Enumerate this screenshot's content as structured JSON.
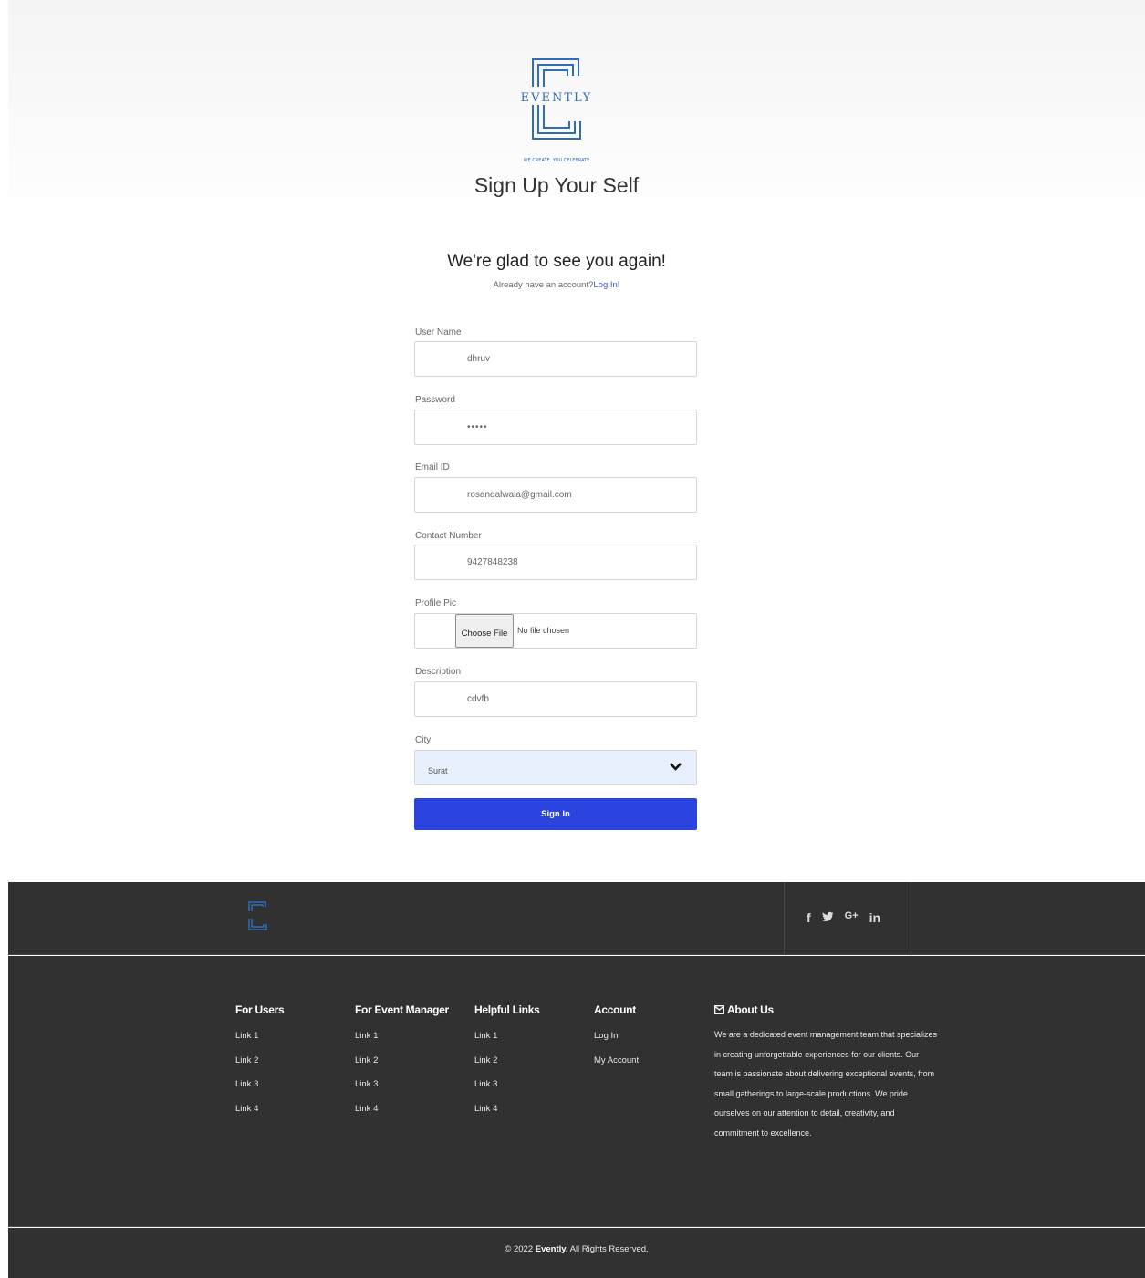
{
  "header": {
    "brand": "EVENTLY",
    "tagline": "WE CREATE, YOU CELEBRATE",
    "page_title": "Sign Up Your Self"
  },
  "intro": {
    "subtitle": "We're glad to see you again!",
    "account_prompt": "Already have an account?",
    "login_link": "Log In!"
  },
  "form": {
    "username": {
      "label": "User Name",
      "value": "dhruv"
    },
    "password": {
      "label": "Password",
      "value": "•••••"
    },
    "email": {
      "label": "Email ID",
      "value": "rosandalwala@gmail.com"
    },
    "contact": {
      "label": "Contact Number",
      "value": "9427848238"
    },
    "profile_pic": {
      "label": "Profile Pic",
      "button": "Choose File",
      "status": "No file chosen"
    },
    "description": {
      "label": "Description",
      "value": "cdvfb"
    },
    "city": {
      "label": "City",
      "value": "Surat"
    },
    "submit": "Sign In"
  },
  "footer": {
    "social": [
      "f",
      "t",
      "G+",
      "in"
    ],
    "columns": [
      {
        "title": "For Users",
        "links": [
          "Link 1",
          "Link 2",
          "Link 3",
          "Link 4"
        ]
      },
      {
        "title": "For Event Manager",
        "links": [
          "Link 1",
          "Link 2",
          "Link 3",
          "Link 4"
        ]
      },
      {
        "title": "Helpful Links",
        "links": [
          "Link 1",
          "Link 2",
          "Link 3",
          "Link 4"
        ]
      },
      {
        "title": "Account",
        "links": [
          "Log In",
          "My Account"
        ]
      }
    ],
    "about": {
      "title": "About Us",
      "text": "We are a dedicated event management team that specializes in creating unforgettable experiences for our clients. Our team is passionate about delivering exceptional events, from small gatherings to large-scale productions. We pride ourselves on our attention to detail, creativity, and commitment to excellence."
    },
    "copyright_prefix": "© 2022",
    "copyright_brand": "Evently.",
    "copyright_suffix": "All Rights Reserved."
  },
  "colors": {
    "brand_blue": "#2f6db5",
    "button_blue": "#2b44e0",
    "footer_bg": "#313131"
  }
}
